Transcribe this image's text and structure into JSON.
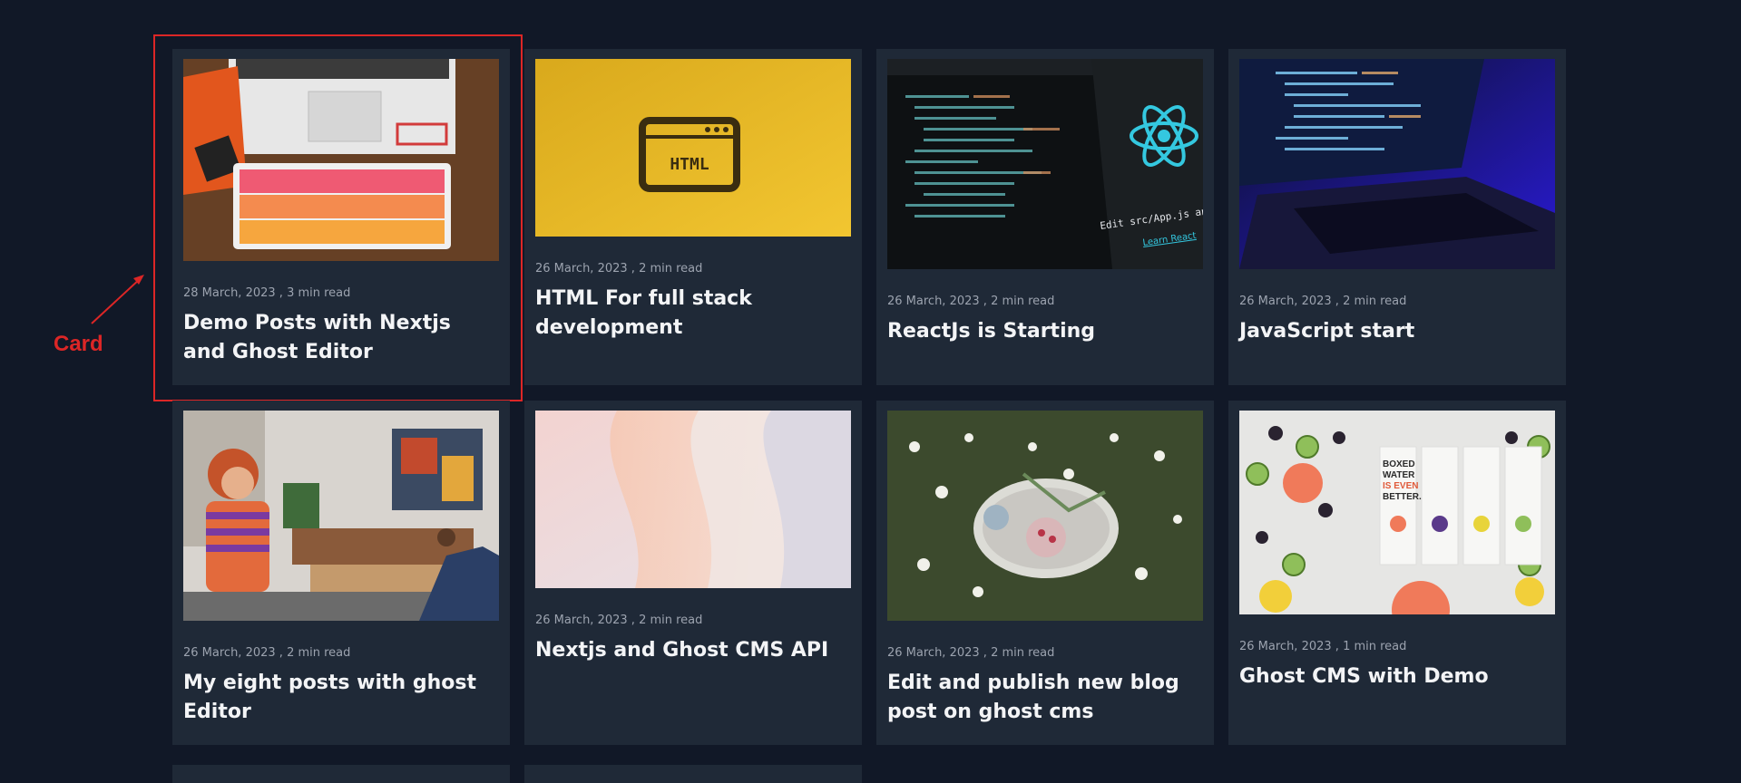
{
  "annotation": {
    "label": "Card",
    "color": "#dc2626"
  },
  "theme": {
    "background": "#111827",
    "card_background": "#1f2937"
  },
  "posts": [
    {
      "image": "npm-laptop-keyboard",
      "date": "28 March, 2023",
      "read_time": "3 min read",
      "title": "Demo Posts with Nextjs and Ghost Editor"
    },
    {
      "image": "html-sign-yellow",
      "date": "26 March, 2023",
      "read_time": "2 min read",
      "title": "HTML For full stack development"
    },
    {
      "image": "react-code-screen",
      "date": "26 March, 2023",
      "read_time": "2 min read",
      "title": "ReactJs is Starting"
    },
    {
      "image": "laptop-blue-code",
      "date": "26 March, 2023",
      "read_time": "2 min read",
      "title": "JavaScript start"
    },
    {
      "image": "woman-living-room",
      "date": "26 March, 2023",
      "read_time": "2 min read",
      "title": "My eight posts with ghost Editor"
    },
    {
      "image": "abstract-pastel-waves",
      "date": "26 March, 2023",
      "read_time": "2 min read",
      "title": "Nextjs and Ghost CMS API"
    },
    {
      "image": "flowers-table-garden",
      "date": "26 March, 2023",
      "read_time": "2 min read",
      "title": "Edit and publish new blog post on ghost cms"
    },
    {
      "image": "boxed-water-fruits",
      "date": "26 March, 2023",
      "read_time": "1 min read",
      "title": "Ghost CMS with Demo"
    }
  ],
  "boxed_water_text": [
    "BOXED",
    "WATER",
    "IS EVEN",
    "BETTER."
  ],
  "html_sign_text": "HTML",
  "react_screen_text": {
    "edit": "Edit src/App.js and save to reload.",
    "link": "Learn React"
  }
}
